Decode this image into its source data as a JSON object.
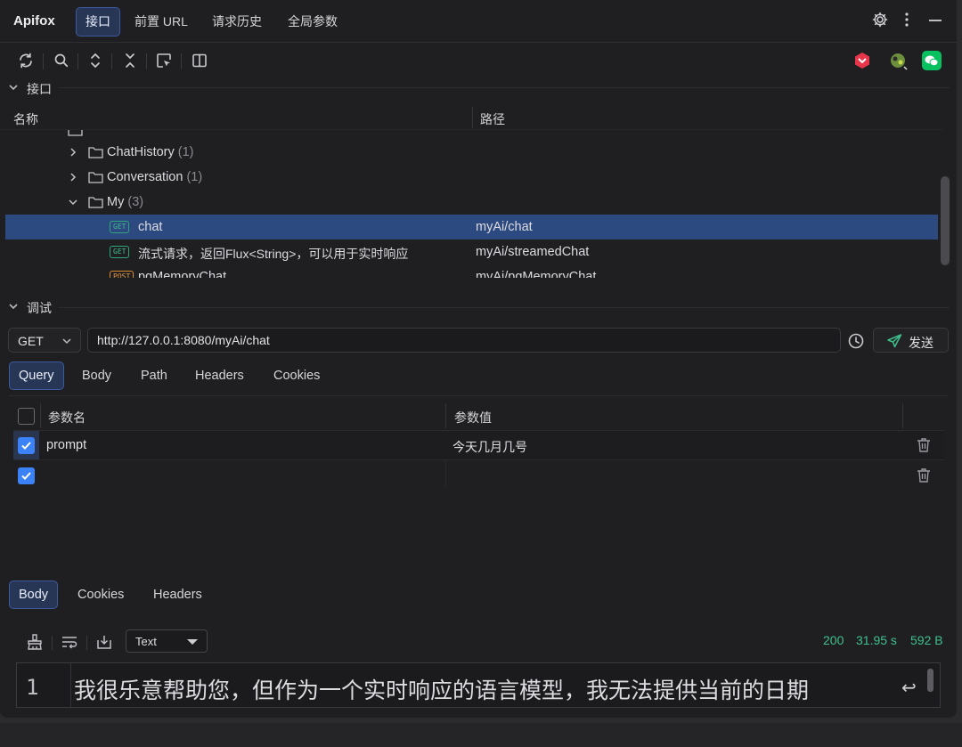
{
  "app": {
    "brand": "Apifox"
  },
  "top_tabs": [
    {
      "label": "接口",
      "active": true
    },
    {
      "label": "前置 URL",
      "active": false
    },
    {
      "label": "请求历史",
      "active": false
    },
    {
      "label": "全局参数",
      "active": false
    }
  ],
  "toolbar": {
    "icons": [
      "refresh-icon",
      "search-icon",
      "expand-icon",
      "collapse-icon",
      "locate-icon",
      "split-view-icon"
    ]
  },
  "api_section": {
    "title": "接口",
    "col_name": "名称",
    "col_path": "路径",
    "tree": [
      {
        "type": "folder",
        "label": "ChatHistory",
        "count": "(1)",
        "expanded": false
      },
      {
        "type": "folder",
        "label": "Conversation",
        "count": "(1)",
        "expanded": false
      },
      {
        "type": "folder",
        "label": "My",
        "count": "(3)",
        "expanded": true
      },
      {
        "type": "api",
        "method": "GET",
        "label": "chat",
        "path": "myAi/chat",
        "selected": true
      },
      {
        "type": "api",
        "method": "GET",
        "label": "流式请求，返回Flux<String>，可以用于实时响应",
        "path": "myAi/streamedChat",
        "selected": false
      },
      {
        "type": "api",
        "method": "POST",
        "label": "pgMemoryChat",
        "path": "myAi/pgMemoryChat",
        "selected": false
      }
    ]
  },
  "debug_section": {
    "title": "调试",
    "method": "GET",
    "url": "http://127.0.0.1:8080/myAi/chat",
    "send_label": "发送",
    "tabs": [
      {
        "label": "Query",
        "active": true
      },
      {
        "label": "Body",
        "active": false
      },
      {
        "label": "Path",
        "active": false
      },
      {
        "label": "Headers",
        "active": false
      },
      {
        "label": "Cookies",
        "active": false
      }
    ],
    "params_header": {
      "name": "参数名",
      "value": "参数值"
    },
    "params": [
      {
        "checked": true,
        "name": "prompt",
        "value": "今天几月几号"
      },
      {
        "checked": true,
        "name": "",
        "value": ""
      }
    ]
  },
  "response": {
    "tabs": [
      {
        "label": "Body",
        "active": true
      },
      {
        "label": "Cookies",
        "active": false
      },
      {
        "label": "Headers",
        "active": false
      }
    ],
    "format": "Text",
    "status": "200",
    "time": "31.95 s",
    "size": "592 B",
    "line_no": "1",
    "body_text": "我很乐意帮助您，但作为一个实时响应的语言模型，我无法提供当前的日期"
  },
  "colors": {
    "accent": "#3b82f6",
    "selected_row": "#2d4a80",
    "status_green": "#3ec08c",
    "get_green": "#2fa77a",
    "post_orange": "#d88a2f"
  }
}
